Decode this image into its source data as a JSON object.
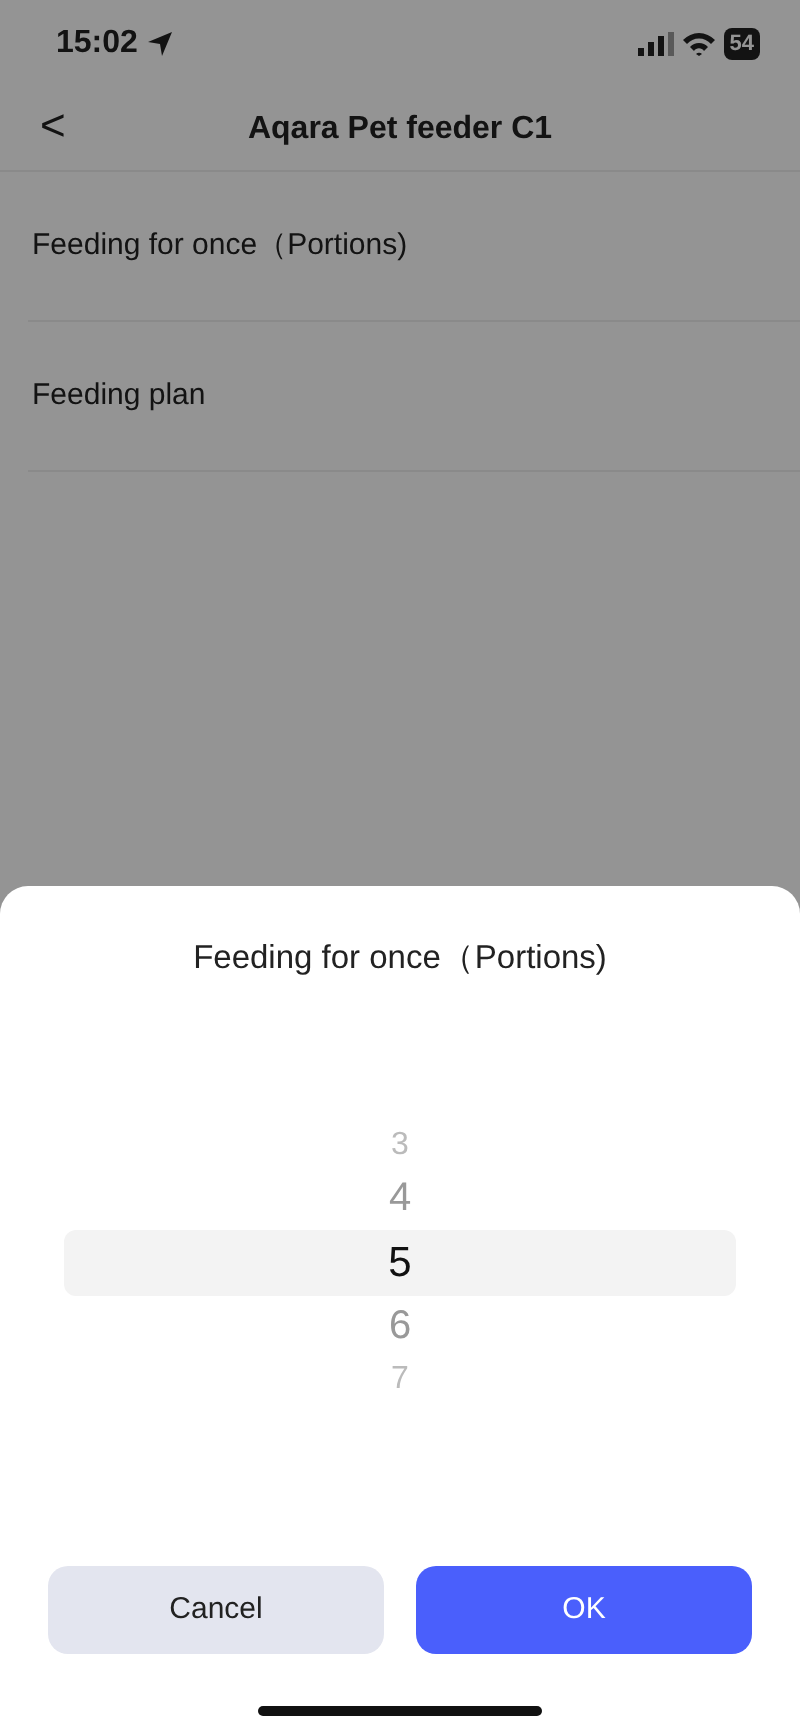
{
  "status_bar": {
    "time": "15:02",
    "battery": "54"
  },
  "header": {
    "back": "<",
    "title": "Aqara Pet feeder C1"
  },
  "settings": [
    {
      "label": "Feeding for once（Portions)"
    },
    {
      "label": "Feeding plan"
    }
  ],
  "sheet": {
    "title": "Feeding for once（Portions)",
    "picker": [
      {
        "value": "3",
        "selected": false
      },
      {
        "value": "4",
        "selected": false
      },
      {
        "value": "5",
        "selected": true
      },
      {
        "value": "6",
        "selected": false
      },
      {
        "value": "7",
        "selected": false
      }
    ],
    "buttons": [
      {
        "label": "Cancel",
        "kind": "secondary"
      },
      {
        "label": "OK",
        "kind": "primary"
      }
    ]
  }
}
